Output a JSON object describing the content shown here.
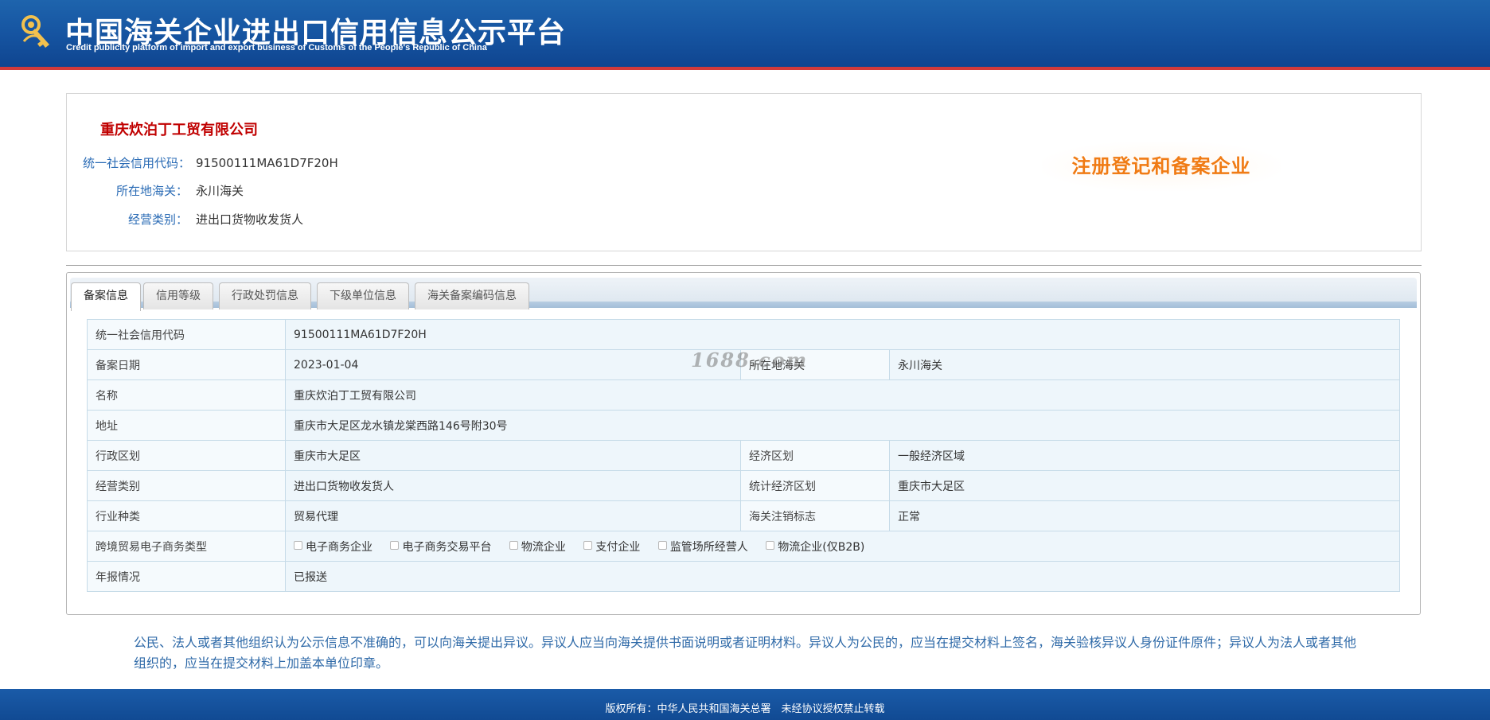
{
  "header": {
    "logo_icon": "customs-emblem-icon",
    "title_cn": "中国海关企业进出口信用信息公示平台",
    "title_en": "Credit publicity platform of import and export business of Customs of the People's Republic of China",
    "bg_color": "#1553a0",
    "accent_line_color": "#d23a3a"
  },
  "company": {
    "name": "重庆炊泊丁工贸有限公司",
    "fields": [
      {
        "label": "统一社会信用代码：",
        "value": "91500111MA61D7F20H"
      },
      {
        "label": "所在地海关：",
        "value": "永川海关"
      },
      {
        "label": "经营类别：",
        "value": "进出口货物收发货人"
      }
    ],
    "badge": "注册登记和备案企业"
  },
  "tabs": [
    {
      "label": "备案信息",
      "active": true
    },
    {
      "label": "信用等级",
      "active": false
    },
    {
      "label": "行政处罚信息",
      "active": false
    },
    {
      "label": "下级单位信息",
      "active": false
    },
    {
      "label": "海关备案编码信息",
      "active": false
    }
  ],
  "table": {
    "credit_code_label": "统一社会信用代码",
    "credit_code_value": "91500111MA61D7F20H",
    "reg_date_label": "备案日期",
    "reg_date_value": "2023-01-04",
    "customs_label": "所在地海关",
    "customs_value": "永川海关",
    "name_label": "名称",
    "name_value": "重庆炊泊丁工贸有限公司",
    "address_label": "地址",
    "address_value": "重庆市大足区龙水镇龙棠西路146号附30号",
    "admin_region_label": "行政区划",
    "admin_region_value": "重庆市大足区",
    "econ_region_label": "经济区划",
    "econ_region_value": "一般经济区域",
    "biz_type_label": "经营类别",
    "biz_type_value": "进出口货物收发货人",
    "stat_region_label": "统计经济区划",
    "stat_region_value": "重庆市大足区",
    "industry_label": "行业种类",
    "industry_value": "贸易代理",
    "cancel_flag_label": "海关注销标志",
    "cancel_flag_value": "正常",
    "ecommerce_label": "跨境贸易电子商务类型",
    "ecommerce_options": [
      "电子商务企业",
      "电子商务交易平台",
      "物流企业",
      "支付企业",
      "监管场所经营人",
      "物流企业(仅B2B)"
    ],
    "annual_report_label": "年报情况",
    "annual_report_value": "已报送"
  },
  "watermark": "1688.com",
  "notice": "公民、法人或者其他组织认为公示信息不准确的，可以向海关提出异议。异议人应当向海关提供书面说明或者证明材料。异议人为公民的，应当在提交材料上签名，海关验核异议人身份证件原件；异议人为法人或者其他组织的，应当在提交材料上加盖本单位印章。",
  "footer": "版权所有：中华人民共和国海关总署　未经协议授权禁止转载"
}
